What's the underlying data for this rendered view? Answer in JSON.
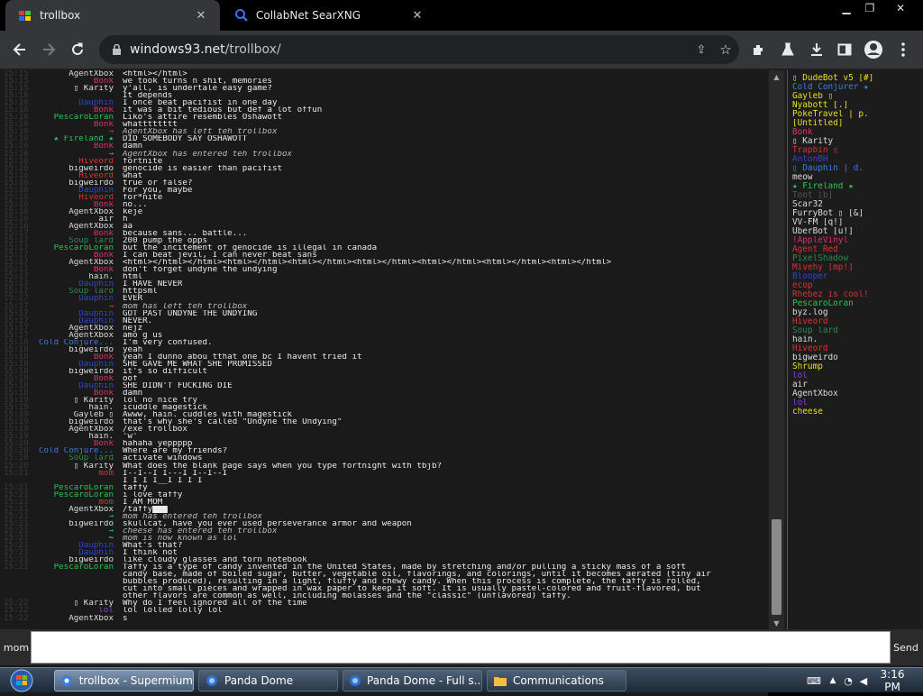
{
  "tabs": [
    {
      "title": "trollbox",
      "active": true,
      "icon": "windows93-favicon"
    },
    {
      "title": "CollabNet SearXNG",
      "active": false,
      "icon": "search-favicon"
    }
  ],
  "address": {
    "host": "windows93.net",
    "path": "/trollbox/"
  },
  "chat": {
    "messages": [
      {
        "t": "15:15",
        "n": "AgentXbox",
        "c": "#ddd",
        "m": "<html></html>"
      },
      {
        "t": "15:15",
        "n": "Bonk",
        "c": "#e0306a",
        "m": "we took turns n shit, memories"
      },
      {
        "t": "15:15",
        "n": "▯ Karity",
        "c": "#ddd",
        "m": "y'all, is undertale easy game?"
      },
      {
        "t": "15:16",
        "n": "",
        "c": "#ddd",
        "m": "It depends"
      },
      {
        "t": "15:16",
        "n": "Dauphin",
        "c": "#2d46c8",
        "m": "I once beat pacifist in one day"
      },
      {
        "t": "15:16",
        "n": "Bonk",
        "c": "#e0306a",
        "m": "it was a bit tedious but def a lot offun"
      },
      {
        "t": "15:16",
        "n": "PescaroLoran",
        "c": "#2ec452",
        "m": "Liko's attire resembles Oshawott"
      },
      {
        "t": "15:16",
        "n": "Bonk",
        "c": "#e0306a",
        "m": "whatttttttt"
      },
      {
        "t": "15:16",
        "n": "→",
        "c": "#e03030",
        "m": "AgentXbox has left teh trollbox",
        "s": true
      },
      {
        "t": "15:16",
        "n": "★ Fireland ★",
        "c": "#2ec452",
        "m": "DID SOMEBODY SAY OSHAWOTT"
      },
      {
        "t": "15:16",
        "n": "Bonk",
        "c": "#e0306a",
        "m": "damn"
      },
      {
        "t": "15:16",
        "n": "→",
        "c": "#2ec452",
        "m": "AgentXbox has entered teh trollbox",
        "s": true
      },
      {
        "t": "15:16",
        "n": "Hiveord",
        "c": "#e03030",
        "m": "fortnite"
      },
      {
        "t": "15:16",
        "n": "bigweirdo",
        "c": "#ddd",
        "m": "genocide is easier than pacifist"
      },
      {
        "t": "15:16",
        "n": "Hiveord",
        "c": "#e03030",
        "m": "what"
      },
      {
        "t": "15:16",
        "n": "bigweirdo",
        "c": "#ddd",
        "m": "true or false?"
      },
      {
        "t": "15:16",
        "n": "Dauphin",
        "c": "#2d46c8",
        "m": "For you, maybe"
      },
      {
        "t": "15:16",
        "n": "Hiveord",
        "c": "#e03030",
        "m": "for*nite"
      },
      {
        "t": "15:16",
        "n": "Bonk",
        "c": "#e0306a",
        "m": "no..."
      },
      {
        "t": "15:16",
        "n": "AgentXbox",
        "c": "#ddd",
        "m": "keje"
      },
      {
        "t": "15:16",
        "n": "air",
        "c": "#ddd",
        "m": "h"
      },
      {
        "t": "15:16",
        "n": "AgentXbox",
        "c": "#ddd",
        "m": "aa"
      },
      {
        "t": "15:17",
        "n": "Bonk",
        "c": "#e0306a",
        "m": "because sans... battle..."
      },
      {
        "t": "15:17",
        "n": "Soup lard",
        "c": "#2d8a4a",
        "m": "200 pump the opps"
      },
      {
        "t": "15:17",
        "n": "PescaroLoran",
        "c": "#2ec452",
        "m": "but the incitement of genocide is illegal in canada"
      },
      {
        "t": "15:17",
        "n": "Bonk",
        "c": "#e0306a",
        "m": "I can beat jevil, I can never beat sans"
      },
      {
        "t": "15:17",
        "n": "AgentXbox",
        "c": "#ddd",
        "m": "<html></html></html><html></html><html></html><html></html><html></html><html></html><html></html>"
      },
      {
        "t": "15:17",
        "n": "Bonk",
        "c": "#e0306a",
        "m": "don't forget undyne the undying"
      },
      {
        "t": "15:17",
        "n": "hain.",
        "c": "#ddd",
        "m": "html"
      },
      {
        "t": "15:17",
        "n": "Dauphin",
        "c": "#2d46c8",
        "m": "I HAVE NEVER"
      },
      {
        "t": "15:17",
        "n": "Soup lard",
        "c": "#2d8a4a",
        "m": "httpsml"
      },
      {
        "t": "15:17",
        "n": "Dauphin",
        "c": "#2d46c8",
        "m": "EVER"
      },
      {
        "t": "15:17",
        "n": "→",
        "c": "#e03030",
        "m": "mom has left teh trollbox",
        "s": true
      },
      {
        "t": "15:17",
        "n": "Dauphin",
        "c": "#2d46c8",
        "m": "GOT PAST UNDYNE THE UNDYING"
      },
      {
        "t": "15:17",
        "n": "Dauphin",
        "c": "#2d46c8",
        "m": "NEVER."
      },
      {
        "t": "15:17",
        "n": "AgentXbox",
        "c": "#ddd",
        "m": "nejz"
      },
      {
        "t": "15:17",
        "n": "AgentXbox",
        "c": "#ddd",
        "m": "amo g us"
      },
      {
        "t": "15:18",
        "n": "Cold Conjure...",
        "c": "#3a7ee0",
        "m": "I'm very confused."
      },
      {
        "t": "15:18",
        "n": "bigweirdo",
        "c": "#ddd",
        "m": "yeah"
      },
      {
        "t": "15:18",
        "n": "Bonk",
        "c": "#e0306a",
        "m": "yeah I dunno abou tthat one bc I havent tried it"
      },
      {
        "t": "15:18",
        "n": "Dauphin",
        "c": "#2d46c8",
        "m": "SHE GAVE ME WHAT SHE PROMISSED"
      },
      {
        "t": "15:18",
        "n": "bigweirdo",
        "c": "#ddd",
        "m": "it's so difficult"
      },
      {
        "t": "15:18",
        "n": "Bonk",
        "c": "#e0306a",
        "m": "oof"
      },
      {
        "t": "15:18",
        "n": "Dauphin",
        "c": "#2d46c8",
        "m": "SHE DIDN'T FUCKING DIE"
      },
      {
        "t": "15:18",
        "n": "Bonk",
        "c": "#e0306a",
        "m": "damn"
      },
      {
        "t": "15:19",
        "n": "▯ Karity",
        "c": "#ddd",
        "m": "lol no nice try"
      },
      {
        "t": "15:19",
        "n": "hain.",
        "c": "#ddd",
        "m": "icuddle magestick"
      },
      {
        "t": "15:19",
        "n": "Gayleb ▯",
        "c": "#ddd",
        "m": "Awww, hain. cuddles with magestick"
      },
      {
        "t": "15:19",
        "n": "bigweirdo",
        "c": "#ddd",
        "m": "that's why she's called \"Undyne the Undying\""
      },
      {
        "t": "15:19",
        "n": "AgentXbox",
        "c": "#ddd",
        "m": "/exe trollbox"
      },
      {
        "t": "15:19",
        "n": "hain.",
        "c": "#ddd",
        "m": "'w'"
      },
      {
        "t": "15:20",
        "n": "Bonk",
        "c": "#e0306a",
        "m": "hahaha yeppppp"
      },
      {
        "t": "15:20",
        "n": "Cold Conjure...",
        "c": "#3a7ee0",
        "m": "Where are my friends?"
      },
      {
        "t": "15:20",
        "n": "Soup lard",
        "c": "#2d8a4a",
        "m": "activate windows"
      },
      {
        "t": "15:20",
        "n": "▯ Karity",
        "c": "#ddd",
        "m": "What does the blank page says when you type fortnight with tbjb?"
      },
      {
        "t": "15:21",
        "n": "mom",
        "c": "#e03030",
        "m": "I--I--I I---I I--I--I"
      },
      {
        "t": "",
        "n": "",
        "c": "#ddd",
        "m": "I I I I__I I I I"
      },
      {
        "t": "15:21",
        "n": "PescaroLoran",
        "c": "#2ec452",
        "m": "taffy"
      },
      {
        "t": "15:21",
        "n": "PescaroLoran",
        "c": "#2ec452",
        "m": "i love taffy"
      },
      {
        "t": "15:21",
        "n": "mom",
        "c": "#e03030",
        "m": "I AM MOM"
      },
      {
        "t": "15:21",
        "n": "AgentXbox",
        "c": "#ddd",
        "m": "/taffy███"
      },
      {
        "t": "15:21",
        "n": "→",
        "c": "#2ec452",
        "m": "mom has entered teh trollbox",
        "s": true
      },
      {
        "t": "15:21",
        "n": "bigweirdo",
        "c": "#ddd",
        "m": "skullcat, have you ever used perseverance armor and weapon"
      },
      {
        "t": "15:21",
        "n": "→",
        "c": "#2ec452",
        "m": "cheese has entered teh trollbox",
        "s": true
      },
      {
        "t": "15:21",
        "n": "~",
        "c": "#ddd",
        "m": "mom is now known as lol",
        "s": true
      },
      {
        "t": "15:21",
        "n": "Dauphin",
        "c": "#2d46c8",
        "m": "What's that?"
      },
      {
        "t": "15:21",
        "n": "Dauphin",
        "c": "#2d46c8",
        "m": "I think not"
      },
      {
        "t": "15:21",
        "n": "bigweirdo",
        "c": "#ddd",
        "m": "like cloudy glasses and torn notebook"
      },
      {
        "t": "15:21",
        "n": "PescaroLoran",
        "c": "#2ec452",
        "m": "Taffy is a type of candy invented in the United States, made by stretching and/or pulling a sticky mass of a soft"
      },
      {
        "t": "",
        "n": "",
        "c": "#ddd",
        "m": "candy base, made of boiled sugar, butter, vegetable oil, flavorings, and colorings, until it becomes aerated (tiny air"
      },
      {
        "t": "",
        "n": "",
        "c": "#ddd",
        "m": "bubbles produced), resulting in a light, fluffy and chewy candy. When this process is complete, the taffy is rolled,"
      },
      {
        "t": "",
        "n": "",
        "c": "#ddd",
        "m": "cut into small pieces and wrapped in wax paper to keep it soft. It is usually pastel-colored and fruit-flavored, but"
      },
      {
        "t": "",
        "n": "",
        "c": "#ddd",
        "m": "other flavors are common as well, including molasses and the \"classic\" (unflavored) taffy."
      },
      {
        "t": "15:22",
        "n": "▯ Karity",
        "c": "#ddd",
        "m": "Why do I feel ignored all of the time"
      },
      {
        "t": "15:22",
        "n": "lol",
        "c": "#8a3ae0",
        "m": "lol lolled lolly lol"
      },
      {
        "t": "15:22",
        "n": "AgentXbox",
        "c": "#ddd",
        "m": "s"
      }
    ],
    "nick": "mom",
    "input_value": "",
    "send_label": "Send"
  },
  "users": [
    {
      "n": "▯ DudeBot v5 [#]",
      "c": "#e8e020"
    },
    {
      "n": "Cold Conjurer ★",
      "c": "#3a7ee0"
    },
    {
      "n": "Gayleb ▯",
      "c": "#e8e020"
    },
    {
      "n": "Nyabott [.]",
      "c": "#e8e020"
    },
    {
      "n": "PokeTravel | p.",
      "c": "#e8e020"
    },
    {
      "n": "[Untitled]",
      "c": "#e8e020"
    },
    {
      "n": "Bonk",
      "c": "#e0306a"
    },
    {
      "n": "▯ Karity",
      "c": "#ddd"
    },
    {
      "n": "Trapbin ▯",
      "c": "#e03030"
    },
    {
      "n": "AntonBH",
      "c": "#2d46c8"
    },
    {
      "n": "▯ Dauphin | d.",
      "c": "#3a7ee0"
    },
    {
      "n": "meow",
      "c": "#ddd"
    },
    {
      "n": "★ Fireland ★",
      "c": "#2ec452"
    },
    {
      "n": "Toot [b]",
      "c": "#555"
    },
    {
      "n": "Scar32",
      "c": "#ddd"
    },
    {
      "n": "FurryBot ▯ [&]",
      "c": "#ddd"
    },
    {
      "n": "VV-FM [q!]",
      "c": "#ddd"
    },
    {
      "n": "UberBot [u!]",
      "c": "#ddd"
    },
    {
      "n": "!AppleVinyl",
      "c": "#e0306a"
    },
    {
      "n": "Agent Red",
      "c": "#e03030"
    },
    {
      "n": "PixelShadow",
      "c": "#2d8a4a"
    },
    {
      "n": "Mivehy [mp!]",
      "c": "#e03030"
    },
    {
      "n": "Blooper",
      "c": "#2d46c8"
    },
    {
      "n": "ecop",
      "c": "#e03030"
    },
    {
      "n": "Rhebez is cool!",
      "c": "#e03030"
    },
    {
      "n": "PescaroLoran",
      "c": "#2ec452"
    },
    {
      "n": "byz.log",
      "c": "#ddd"
    },
    {
      "n": "Hiveord",
      "c": "#e03030"
    },
    {
      "n": "Soup lard",
      "c": "#2d8a4a"
    },
    {
      "n": "hain.",
      "c": "#ddd"
    },
    {
      "n": "Hiveord",
      "c": "#e03030"
    },
    {
      "n": "bigweirdo",
      "c": "#ddd"
    },
    {
      "n": "Shrump",
      "c": "#e8e020"
    },
    {
      "n": "lol",
      "c": "#8a3ae0"
    },
    {
      "n": "air",
      "c": "#ddd"
    },
    {
      "n": "AgentXbox",
      "c": "#ddd"
    },
    {
      "n": "lol",
      "c": "#8a3ae0"
    },
    {
      "n": "cheese",
      "c": "#e8e020"
    }
  ],
  "taskbar": {
    "items": [
      {
        "label": "trollbox - Supermium",
        "active": true,
        "icon": "browser-icon"
      },
      {
        "label": "Panda Dome",
        "active": false,
        "icon": "panda-icon"
      },
      {
        "label": "Panda Dome - Full s...",
        "active": false,
        "icon": "panda-icon"
      },
      {
        "label": "Communications",
        "active": false,
        "icon": "folder-icon"
      }
    ],
    "clock": "3:16 PM"
  }
}
